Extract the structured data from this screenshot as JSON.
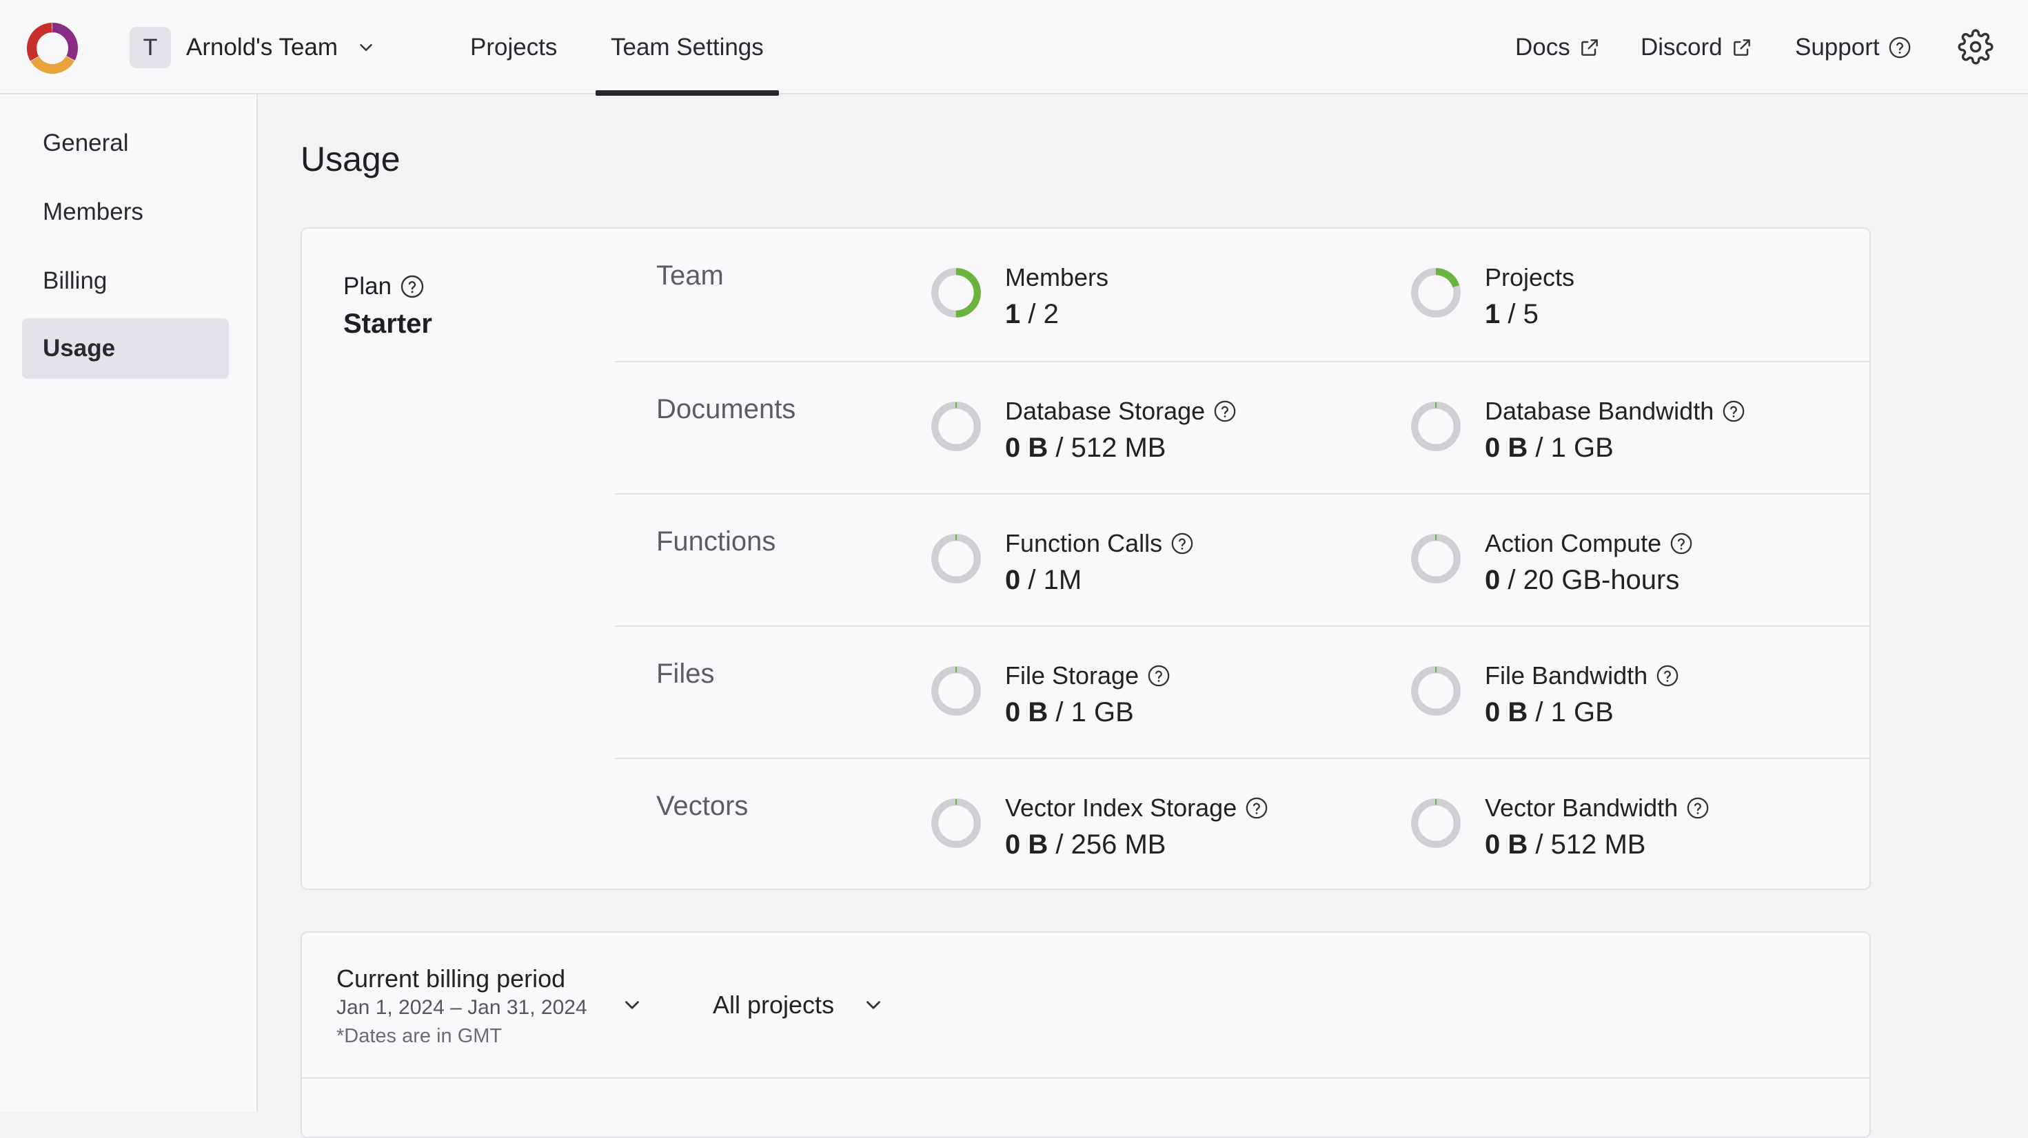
{
  "header": {
    "team_initial": "T",
    "team_name": "Arnold's Team",
    "tabs": [
      "Projects",
      "Team Settings"
    ],
    "active_tab": "Team Settings",
    "links": [
      "Docs",
      "Discord",
      "Support"
    ]
  },
  "sidebar": {
    "items": [
      "General",
      "Members",
      "Billing",
      "Usage"
    ],
    "active": "Usage"
  },
  "page": {
    "title": "Usage"
  },
  "plan": {
    "label": "Plan",
    "name": "Starter"
  },
  "usage_rows": [
    {
      "title": "Team",
      "metrics": [
        {
          "label": "Members",
          "used": "1",
          "limit": "2",
          "fraction": 0.5,
          "help": false
        },
        {
          "label": "Projects",
          "used": "1",
          "limit": "5",
          "fraction": 0.2,
          "help": false
        }
      ]
    },
    {
      "title": "Documents",
      "metrics": [
        {
          "label": "Database Storage",
          "used": "0 B",
          "limit": "512 MB",
          "fraction": 0,
          "help": true
        },
        {
          "label": "Database Bandwidth",
          "used": "0 B",
          "limit": "1 GB",
          "fraction": 0,
          "help": true
        }
      ]
    },
    {
      "title": "Functions",
      "metrics": [
        {
          "label": "Function Calls",
          "used": "0",
          "limit": "1M",
          "fraction": 0,
          "help": true
        },
        {
          "label": "Action Compute",
          "used": "0",
          "limit": "20 GB-hours",
          "fraction": 0,
          "help": true
        }
      ]
    },
    {
      "title": "Files",
      "metrics": [
        {
          "label": "File Storage",
          "used": "0 B",
          "limit": "1 GB",
          "fraction": 0,
          "help": true
        },
        {
          "label": "File Bandwidth",
          "used": "0 B",
          "limit": "1 GB",
          "fraction": 0,
          "help": true
        }
      ]
    },
    {
      "title": "Vectors",
      "metrics": [
        {
          "label": "Vector Index Storage",
          "used": "0 B",
          "limit": "256 MB",
          "fraction": 0,
          "help": true
        },
        {
          "label": "Vector Bandwidth",
          "used": "0 B",
          "limit": "512 MB",
          "fraction": 0,
          "help": true
        }
      ]
    }
  ],
  "billing": {
    "title": "Current billing period",
    "range": "Jan 1, 2024 – Jan 31, 2024",
    "note": "*Dates are in GMT",
    "project_filter": "All projects"
  },
  "colors": {
    "ring_track": "#cfcfd4",
    "ring_fill": "#6bb33f",
    "active_tab_underline": "#26262b",
    "logo": [
      "#e8a43b",
      "#c9302c",
      "#8b2c84"
    ]
  },
  "icons": [
    "chevron-down-icon",
    "external-link-icon",
    "help-circle-icon",
    "gear-icon"
  ]
}
